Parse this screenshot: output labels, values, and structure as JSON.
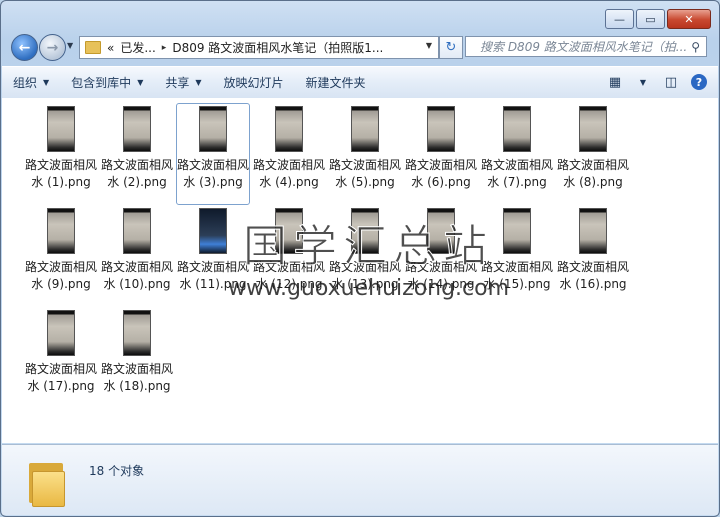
{
  "window": {
    "caption_buttons": [
      "—",
      "▭",
      "✕"
    ]
  },
  "address": {
    "prefix": "«",
    "crumbs": [
      "已发...",
      "D809 路文波面相风水笔记（拍照版1..."
    ],
    "separator": "▸"
  },
  "search": {
    "placeholder": "搜索 D809 路文波面相风水笔记（拍...",
    "icon": "magnifier-icon"
  },
  "toolbar": {
    "organize": "组织",
    "include_in_library": "包含到库中",
    "share": "共享",
    "slideshow": "放映幻灯片",
    "new_folder": "新建文件夹",
    "dropdown_arrow": "▼"
  },
  "files": [
    {
      "name": "路文波面相风水 (1).png"
    },
    {
      "name": "路文波面相风水 (2).png"
    },
    {
      "name": "路文波面相风水 (3).png"
    },
    {
      "name": "路文波面相风水 (4).png"
    },
    {
      "name": "路文波面相风水 (5).png"
    },
    {
      "name": "路文波面相风水 (6).png"
    },
    {
      "name": "路文波面相风水 (7).png"
    },
    {
      "name": "路文波面相风水 (8).png"
    },
    {
      "name": "路文波面相风水 (9).png"
    },
    {
      "name": "路文波面相风水 (10).png"
    },
    {
      "name": "路文波面相风水 (11).png"
    },
    {
      "name": "路文波面相风水 (12).png"
    },
    {
      "name": "路文波面相风水 (13).png"
    },
    {
      "name": "路文波面相风水 (14).png"
    },
    {
      "name": "路文波面相风水 (15).png"
    },
    {
      "name": "路文波面相风水 (16).png"
    },
    {
      "name": "路文波面相风水 (17).png"
    },
    {
      "name": "路文波面相风水 (18).png"
    }
  ],
  "selected_index": 2,
  "watermark": {
    "line1": "国学汇总站",
    "line2": "www.guoxuehuizong.com"
  },
  "details": {
    "count_text": "18 个对象"
  }
}
